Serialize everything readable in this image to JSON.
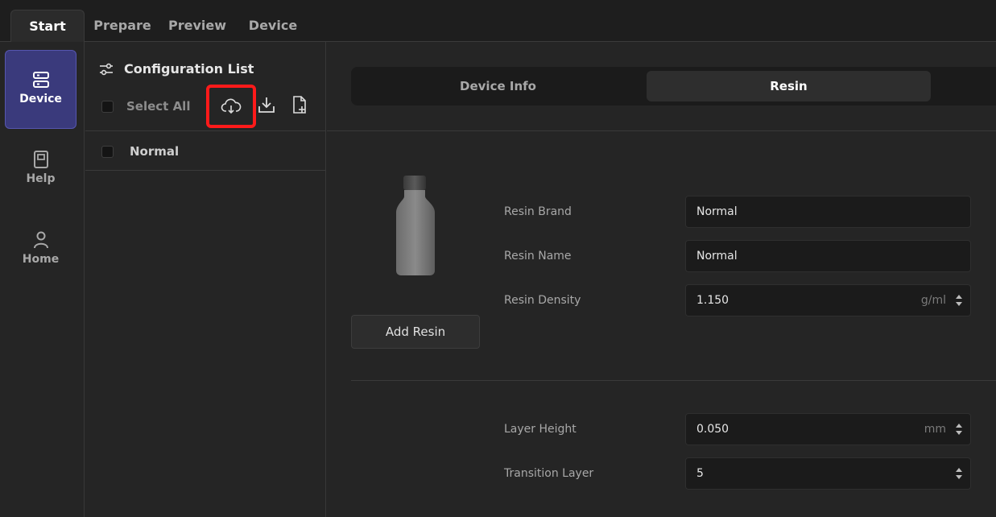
{
  "tabs": [
    {
      "label": "Start",
      "active": true
    },
    {
      "label": "Prepare",
      "active": false
    },
    {
      "label": "Preview",
      "active": false
    },
    {
      "label": "Device",
      "active": false
    }
  ],
  "rail": {
    "items": [
      {
        "label": "Device",
        "icon": "server-icon",
        "active": true
      },
      {
        "label": "Help",
        "icon": "book-icon",
        "active": false
      },
      {
        "label": "Home",
        "icon": "user-icon",
        "active": false
      }
    ]
  },
  "config": {
    "title": "Configuration List",
    "select_all": "Select All",
    "items": [
      {
        "label": "Normal"
      }
    ]
  },
  "main": {
    "segments": [
      {
        "label": "Device Info",
        "active": false
      },
      {
        "label": "Resin",
        "active": true
      }
    ],
    "add_resin": "Add Resin",
    "fields": {
      "resin_brand": {
        "label": "Resin Brand",
        "value": "Normal"
      },
      "resin_name": {
        "label": "Resin Name",
        "value": "Normal"
      },
      "resin_density": {
        "label": "Resin Density",
        "value": "1.150",
        "unit": "g/ml"
      },
      "layer_height": {
        "label": "Layer Height",
        "value": "0.050",
        "unit": "mm"
      },
      "transition_layer": {
        "label": "Transition Layer",
        "value": "5"
      }
    }
  },
  "colors": {
    "accent": "#3a3a7c",
    "highlight_box": "#ff1a1a",
    "background": "#252525"
  }
}
